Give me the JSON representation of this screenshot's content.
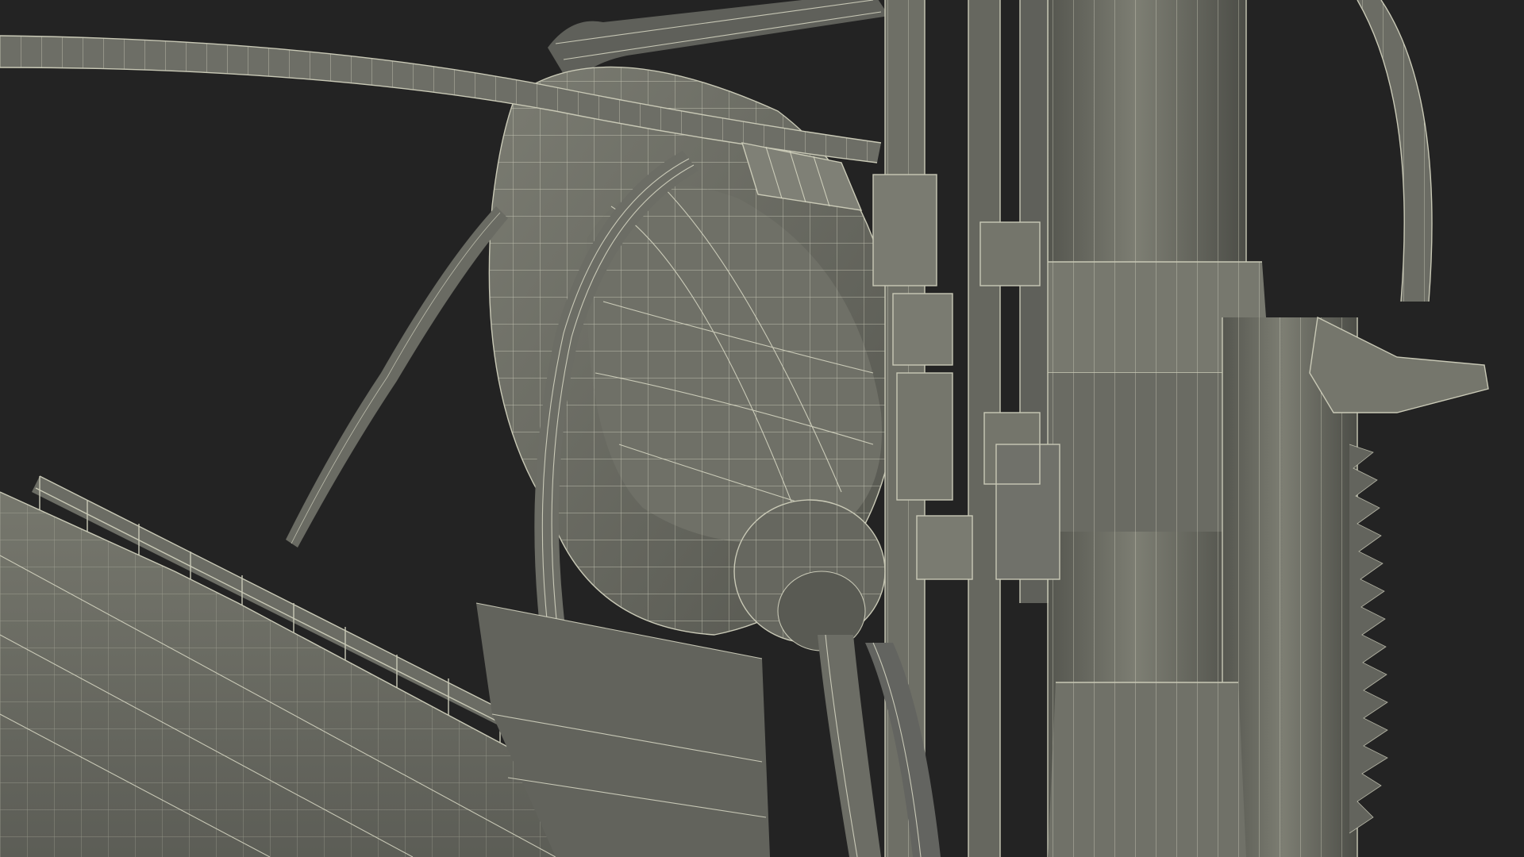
{
  "scene": {
    "background_color": "#232323",
    "mesh_fill_color": "#6e6f66",
    "mesh_shadow_color": "#4a4b45",
    "mesh_highlight_color": "#8a8b80",
    "wire_color": "#d9d9c6"
  }
}
